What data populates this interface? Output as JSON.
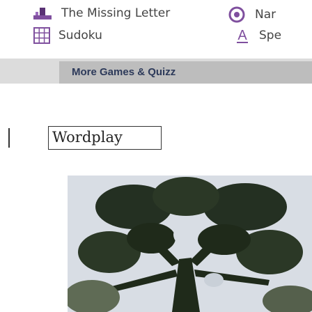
{
  "links": [
    {
      "label": "The Missing Letter",
      "icon": "missing-letter-icon"
    },
    {
      "label": "Nar",
      "icon": "target-icon"
    },
    {
      "label": "Sudoku",
      "icon": "sudoku-grid-icon"
    },
    {
      "label": "Spe",
      "icon": "letter-a-icon"
    }
  ],
  "banner": {
    "label": "More Games & Quizz"
  },
  "section": {
    "title": "Wordplay"
  },
  "hero": {
    "alt": "Game image"
  },
  "colors": {
    "banner_bg": "#dcdcdc",
    "button_bg": "#bdbdbd",
    "button_text": "#2d3a5a",
    "link_text": "#444444",
    "sky": "#d8dde4",
    "tree_dark": "#1f2a1a"
  }
}
